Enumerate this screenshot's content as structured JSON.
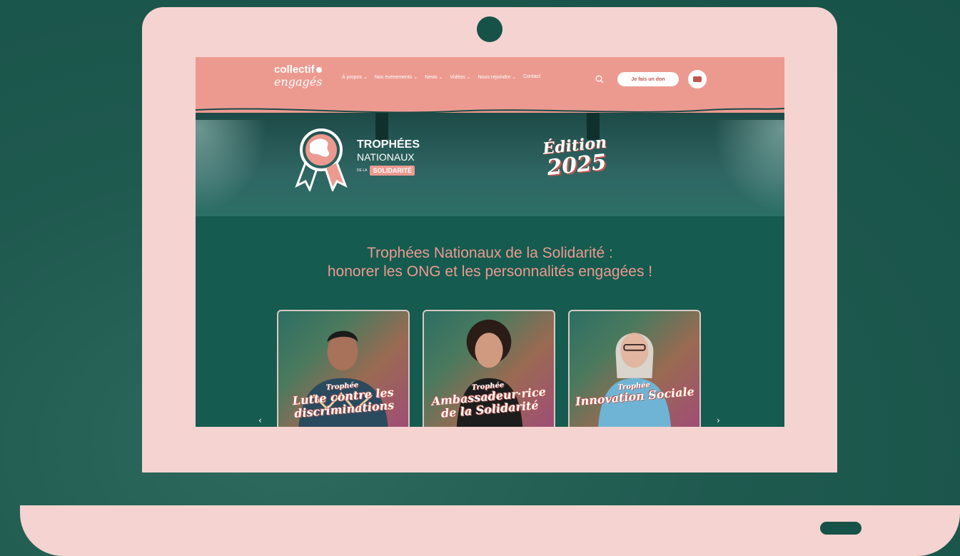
{
  "site": {
    "logo": {
      "line1": "collectif",
      "line2": "engagés"
    },
    "nav": [
      "À propos ⌄",
      "Nos événements ⌄",
      "News ⌄",
      "Vidéos ⌄",
      "Nous rejoindre ⌄",
      "Contact"
    ],
    "donate_label": "Je fais un don"
  },
  "hero": {
    "title_line1": "TROPHÉES",
    "title_line2": "NATIONAUX",
    "title_small": "DE LA",
    "title_tag": "SOLIDARITÉ",
    "edition_word": "Édition",
    "edition_year": "2025"
  },
  "main": {
    "heading_line1": "Trophées Nationaux de la Solidarité :",
    "heading_line2": "honorer les ONG et les personnalités engagées !"
  },
  "cards": [
    {
      "kicker": "Trophée",
      "title": "Lutte contre les discriminations"
    },
    {
      "kicker": "Trophée",
      "title": "Ambassadeur·rice de la Solidarité"
    },
    {
      "kicker": "Trophée",
      "title": "Innovation Sociale"
    }
  ],
  "carousel": {
    "prev": "‹",
    "next": "›"
  },
  "colors": {
    "coral": "#ec9a90",
    "green": "#155b4f",
    "pink_frame": "#f5d3d0"
  }
}
